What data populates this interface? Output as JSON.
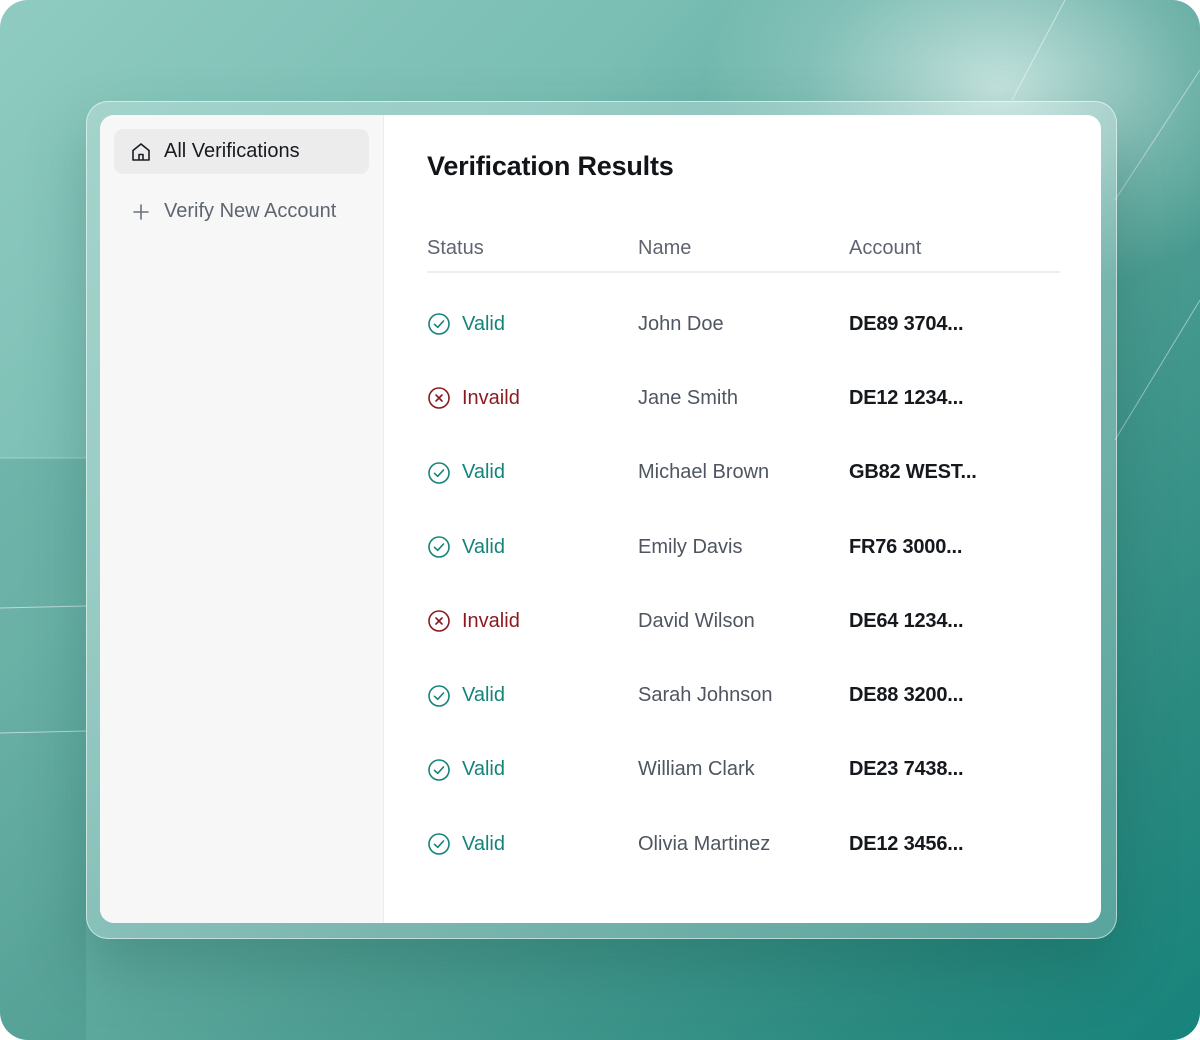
{
  "sidebar": {
    "items": [
      {
        "label": "All Verifications",
        "icon": "home-icon",
        "active": true
      },
      {
        "label": "Verify New Account",
        "icon": "plus-icon",
        "active": false
      }
    ]
  },
  "main": {
    "title": "Verification Results",
    "columns": {
      "status": "Status",
      "name": "Name",
      "account": "Account"
    },
    "rows": [
      {
        "status": "Valid",
        "state": "valid",
        "name": "John Doe",
        "account": "DE89 3704..."
      },
      {
        "status": "Invaild",
        "state": "invalid",
        "name": "Jane Smith",
        "account": "DE12 1234..."
      },
      {
        "status": "Valid",
        "state": "valid",
        "name": "Michael Brown",
        "account": "GB82 WEST..."
      },
      {
        "status": "Valid",
        "state": "valid",
        "name": "Emily Davis",
        "account": "FR76 3000..."
      },
      {
        "status": "Invalid",
        "state": "invalid",
        "name": "David Wilson",
        "account": "DE64 1234..."
      },
      {
        "status": "Valid",
        "state": "valid",
        "name": "Sarah Johnson",
        "account": "DE88 3200..."
      },
      {
        "status": "Valid",
        "state": "valid",
        "name": "William Clark",
        "account": "DE23 7438..."
      },
      {
        "status": "Valid",
        "state": "valid",
        "name": "Olivia Martinez",
        "account": "DE12 3456..."
      }
    ]
  },
  "colors": {
    "valid": "#14837a",
    "invalid": "#8b1a1f",
    "background_teal": "#2a8a80"
  },
  "icons": {
    "valid": "check-circle-icon",
    "invalid": "x-circle-icon"
  }
}
